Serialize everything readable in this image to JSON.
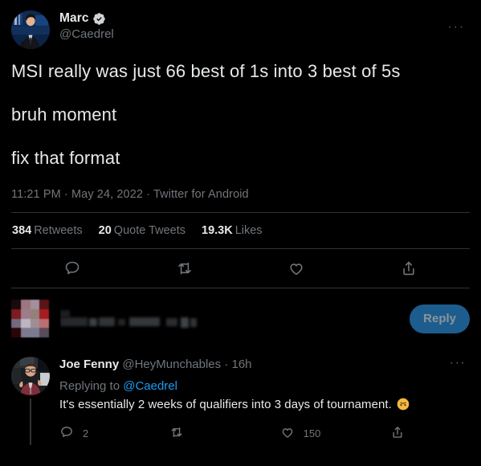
{
  "theme": {
    "background": "#000000",
    "text_primary": "#e7e9ea",
    "text_secondary": "#71767b",
    "link": "#1d9bf0",
    "divider": "#2f3336",
    "reply_button_bg": "#1d5d8e",
    "reply_button_text": "#8b9499"
  },
  "tweet": {
    "author": {
      "display_name": "Marc",
      "handle": "@Caedrel",
      "verified": true,
      "avatar_alt": "man-in-suit-on-blue-stage"
    },
    "more_label": "···",
    "body_lines": [
      "MSI really was just 66 best of 1s into 3 best of 5s",
      "bruh moment",
      "fix that format"
    ],
    "meta": "11:21 PM · May 24, 2022 · Twitter for Android",
    "stats": [
      {
        "count": "384",
        "label": "Retweets"
      },
      {
        "count": "20",
        "label": "Quote Tweets"
      },
      {
        "count": "19.3K",
        "label": "Likes"
      }
    ],
    "actions": [
      {
        "name": "reply",
        "icon": "comment-icon"
      },
      {
        "name": "retweet",
        "icon": "retweet-icon"
      },
      {
        "name": "like",
        "icon": "heart-icon"
      },
      {
        "name": "share",
        "icon": "share-icon"
      }
    ]
  },
  "composer": {
    "avatar_alt": "pixelated-redacted-avatar",
    "placeholder_redacted": true,
    "reply_label": "Reply"
  },
  "reply": {
    "author": {
      "display_name": "Joe Fenny",
      "handle": "@HeyMunchables",
      "avatar_alt": "man-with-glasses-in-maroon-shirt"
    },
    "separator": "·",
    "timestamp": "16h",
    "more_label": "···",
    "replying_to_prefix": "Replying to ",
    "replying_to_handle": "@Caedrel",
    "text": "It's essentially 2 weeks of qualifiers into 3 days of tournament.",
    "emoji": "upside-down-face",
    "actions": [
      {
        "name": "reply",
        "icon": "comment-icon",
        "count": "2"
      },
      {
        "name": "retweet",
        "icon": "retweet-icon",
        "count": ""
      },
      {
        "name": "like",
        "icon": "heart-icon",
        "count": "150"
      },
      {
        "name": "share",
        "icon": "share-icon",
        "count": ""
      }
    ]
  }
}
